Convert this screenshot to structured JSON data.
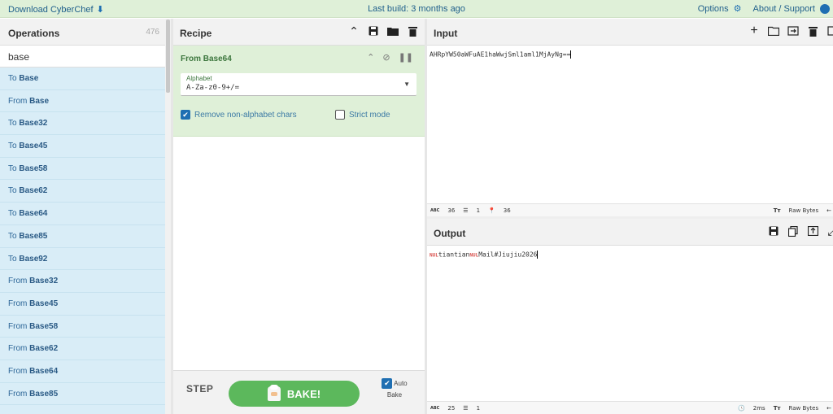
{
  "banner": {
    "download": "Download CyberChef",
    "last_build": "Last build: 3 months ago",
    "options": "Options",
    "about": "About / Support"
  },
  "operations": {
    "title": "Operations",
    "count": "476",
    "search_value": "base",
    "items": [
      {
        "prefix": "To ",
        "bold": "Base"
      },
      {
        "prefix": "From ",
        "bold": "Base"
      },
      {
        "prefix": "To ",
        "bold": "Base32"
      },
      {
        "prefix": "To ",
        "bold": "Base45"
      },
      {
        "prefix": "To ",
        "bold": "Base58"
      },
      {
        "prefix": "To ",
        "bold": "Base62"
      },
      {
        "prefix": "To ",
        "bold": "Base64"
      },
      {
        "prefix": "To ",
        "bold": "Base85"
      },
      {
        "prefix": "To ",
        "bold": "Base92"
      },
      {
        "prefix": "From ",
        "bold": "Base32"
      },
      {
        "prefix": "From ",
        "bold": "Base45"
      },
      {
        "prefix": "From ",
        "bold": "Base58"
      },
      {
        "prefix": "From ",
        "bold": "Base62"
      },
      {
        "prefix": "From ",
        "bold": "Base64"
      },
      {
        "prefix": "From ",
        "bold": "Base85"
      }
    ]
  },
  "recipe": {
    "title": "Recipe",
    "operation_name": "From Base64",
    "alphabet_label": "Alphabet",
    "alphabet_value": "A-Za-z0-9+/=",
    "remove_non_alpha": "Remove non-alphabet chars",
    "remove_non_alpha_checked": true,
    "strict_mode": "Strict mode",
    "strict_mode_checked": false,
    "step_label": "STEP",
    "bake_label": "BAKE!",
    "auto_bake_label": "Auto Bake",
    "auto_bake_checked": true
  },
  "input": {
    "title": "Input",
    "text": "AHRpYW50aWFuAE1haWwjSml1aml1MjAyNg==",
    "stats": {
      "chars": "36",
      "lines": "1",
      "pos": "36"
    },
    "encoding": "Raw Bytes"
  },
  "output": {
    "title": "Output",
    "nul_marker": "NUL",
    "part1": "tiantian",
    "part2": "Mail#Jiujiu2026",
    "stats": {
      "chars": "25",
      "lines": "1"
    },
    "time": "2ms",
    "encoding": "Raw Bytes"
  },
  "colors": {
    "accent_blue": "#1f6fb2",
    "bake_green": "#5cb85c",
    "op_card_bg": "#dff0d8",
    "ops_list_bg": "#d9edf7"
  }
}
